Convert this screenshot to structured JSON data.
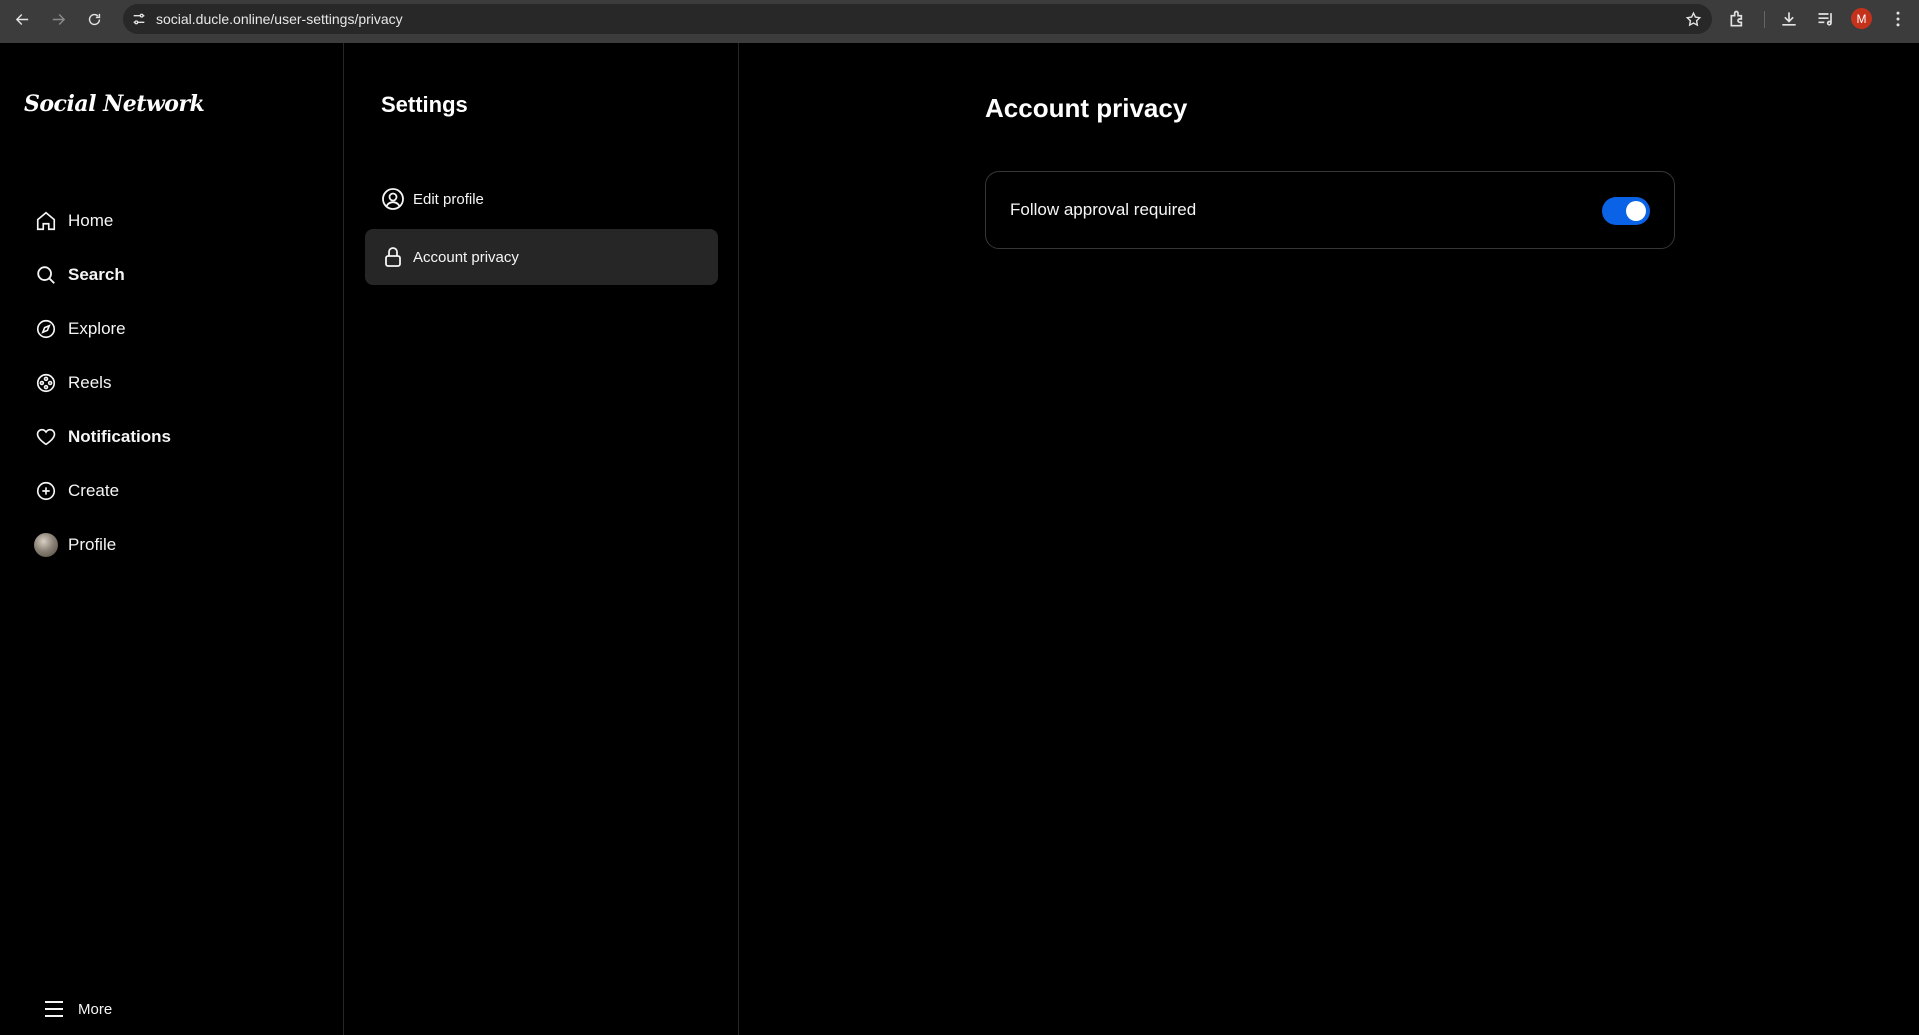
{
  "browser": {
    "url": "social.ducle.online/user-settings/privacy",
    "profile_initial": "M",
    "profile_color": "#c5321c"
  },
  "app": {
    "logo": "Social Network"
  },
  "leftnav": {
    "items": [
      {
        "label": "Home",
        "icon": "home-icon"
      },
      {
        "label": "Search",
        "icon": "search-icon"
      },
      {
        "label": "Explore",
        "icon": "compass-icon"
      },
      {
        "label": "Reels",
        "icon": "reels-icon"
      },
      {
        "label": "Notifications",
        "icon": "heart-icon"
      },
      {
        "label": "Create",
        "icon": "plus-circle-icon"
      },
      {
        "label": "Profile",
        "icon": "avatar"
      }
    ],
    "more_label": "More"
  },
  "settings": {
    "title": "Settings",
    "items": [
      {
        "label": "Edit profile",
        "icon": "user-circle-icon",
        "active": false
      },
      {
        "label": "Account privacy",
        "icon": "lock-icon",
        "active": true
      }
    ]
  },
  "main": {
    "title": "Account privacy",
    "follow_approval_label": "Follow approval required",
    "follow_approval_enabled": true,
    "accent_color": "#0a62e6"
  }
}
